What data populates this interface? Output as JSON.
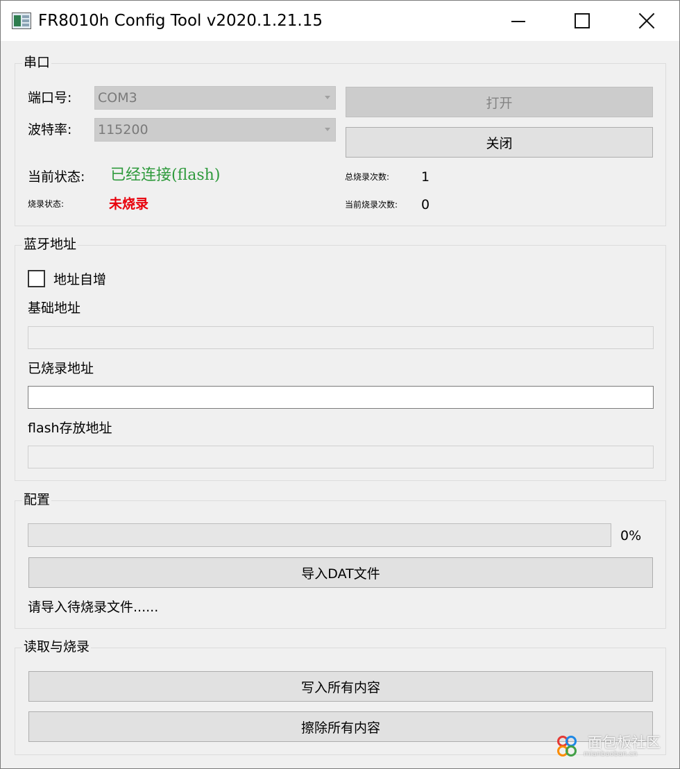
{
  "window": {
    "title": "FR8010h Config Tool v2020.1.21.15"
  },
  "serial": {
    "group_title": "串口",
    "port_label": "端口号:",
    "port_value": "COM3",
    "baud_label": "波特率:",
    "baud_value": "115200",
    "open_label": "打开",
    "close_label": "关闭",
    "state_label": "当前状态:",
    "state_value": "已经连接(flash)",
    "burn_state_label": "烧录状态:",
    "burn_state_value": "未烧录",
    "total_count_label": "总烧录次数:",
    "total_count_value": "1",
    "current_count_label": "当前烧录次数:",
    "current_count_value": "0"
  },
  "bluetooth": {
    "group_title": "蓝牙地址",
    "auto_increment_label": "地址自增",
    "auto_increment_checked": false,
    "base_addr_label": "基础地址",
    "base_addr_value": "",
    "burned_addr_label": "已烧录地址",
    "burned_addr_value": "",
    "flash_addr_label": "flash存放地址",
    "flash_addr_value": ""
  },
  "config": {
    "group_title": "配置",
    "progress_percent": 0,
    "progress_text": "0%",
    "import_label": "导入DAT文件",
    "hint": "请导入待烧录文件......"
  },
  "read_burn": {
    "group_title": "读取与烧录",
    "write_label": "写入所有内容",
    "erase_label": "擦除所有内容"
  },
  "watermark": {
    "name": "面包板社区",
    "url": "mianbaoban.cn"
  },
  "colors": {
    "status_ok": "#2e9a3c",
    "status_error": "#e8000b",
    "progress_fill": "#06b025"
  }
}
